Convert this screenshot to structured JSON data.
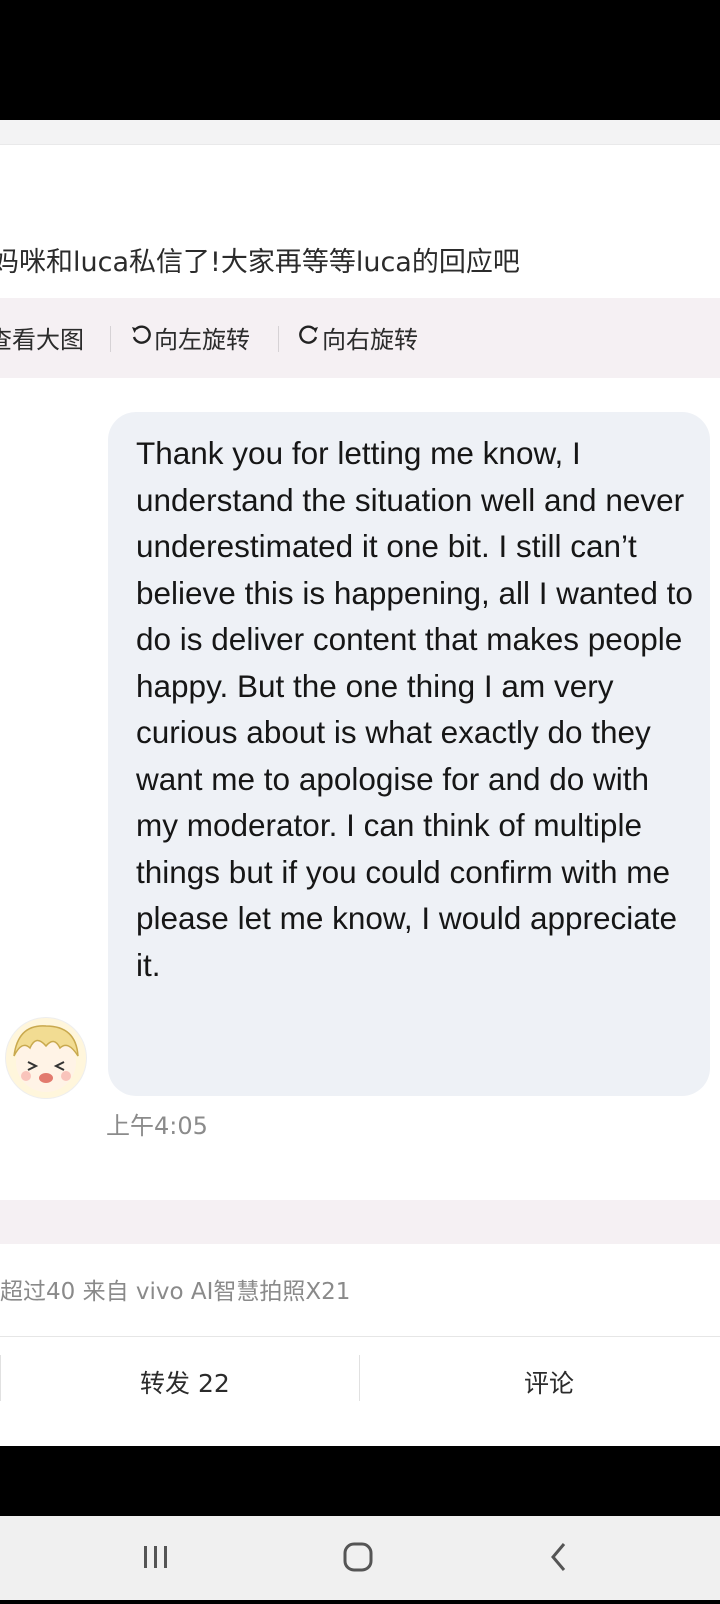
{
  "post": {
    "text": "妈咪和luca私信了!大家再等等luca的回应吧"
  },
  "image_toolbar": {
    "view_large": "查看大图",
    "rotate_left": "向左旋转",
    "rotate_right": "向右旋转"
  },
  "message": {
    "text": "Thank you for letting me know, I understand the situation well and never underestimated it one bit. I still can’t believe this is happening, all I wanted to do is deliver content that makes people happy. But the one thing I am very curious about is what exactly do they want me to apologise for and do with my moderator. I can think of multiple things but if you could confirm with me please let me know, I would appreciate it.",
    "time": "上午4:05"
  },
  "meta": {
    "source_line": "超过40  来自 vivo AI智慧拍照X21"
  },
  "actions": {
    "repost": "转发 22",
    "comment": "评论"
  },
  "icons": {
    "rotate_left": "rotate-left-icon",
    "rotate_right": "rotate-right-icon",
    "nav_recents": "recents-icon",
    "nav_home": "home-icon",
    "nav_back": "back-icon"
  }
}
